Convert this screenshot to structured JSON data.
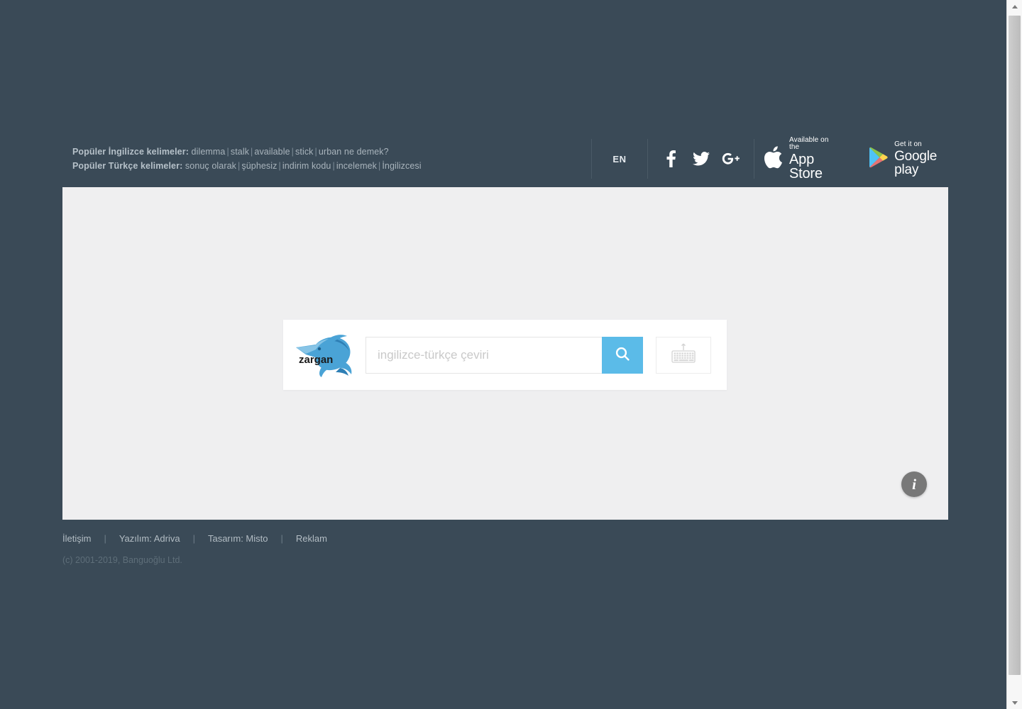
{
  "header": {
    "popular_english": {
      "label": "Popüler İngilizce kelimeler:",
      "words": [
        "dilemma",
        "stalk",
        "available",
        "stick",
        "urban ne demek?"
      ]
    },
    "popular_turkish": {
      "label": "Popüler Türkçe kelimeler:",
      "words": [
        "sonuç olarak",
        "şüphesiz",
        "indirim kodu",
        "incelemek",
        "İngilizcesi"
      ]
    },
    "language": "EN",
    "social": [
      {
        "name": "facebook-icon",
        "label": "f"
      },
      {
        "name": "twitter-icon",
        "label": "t"
      },
      {
        "name": "googleplus-icon",
        "label": "g+"
      }
    ],
    "stores": {
      "appstore": {
        "top": "Available on the",
        "bottom": "App Store"
      },
      "googleplay": {
        "top": "Get it on",
        "bottom_a": "Google",
        "bottom_b": "play"
      }
    }
  },
  "search": {
    "logo_text": "zargan",
    "placeholder": "ingilizce-türkçe çeviri",
    "value": "",
    "search_icon": "search-icon",
    "keyboard_icon": "keyboard-icon"
  },
  "info_button": {
    "label": "i"
  },
  "footer": {
    "links": [
      "İletişim",
      "Yazılım: Adriva",
      "Tasarım: Misto",
      "Reklam"
    ],
    "separator": "|",
    "copyright": "(c) 2001-2019, Banguoğlu Ltd."
  },
  "colors": {
    "background": "#3a4a57",
    "panel": "#efeff0",
    "accent": "#5bbbe8",
    "card": "#ffffff",
    "info_button": "#787878"
  }
}
